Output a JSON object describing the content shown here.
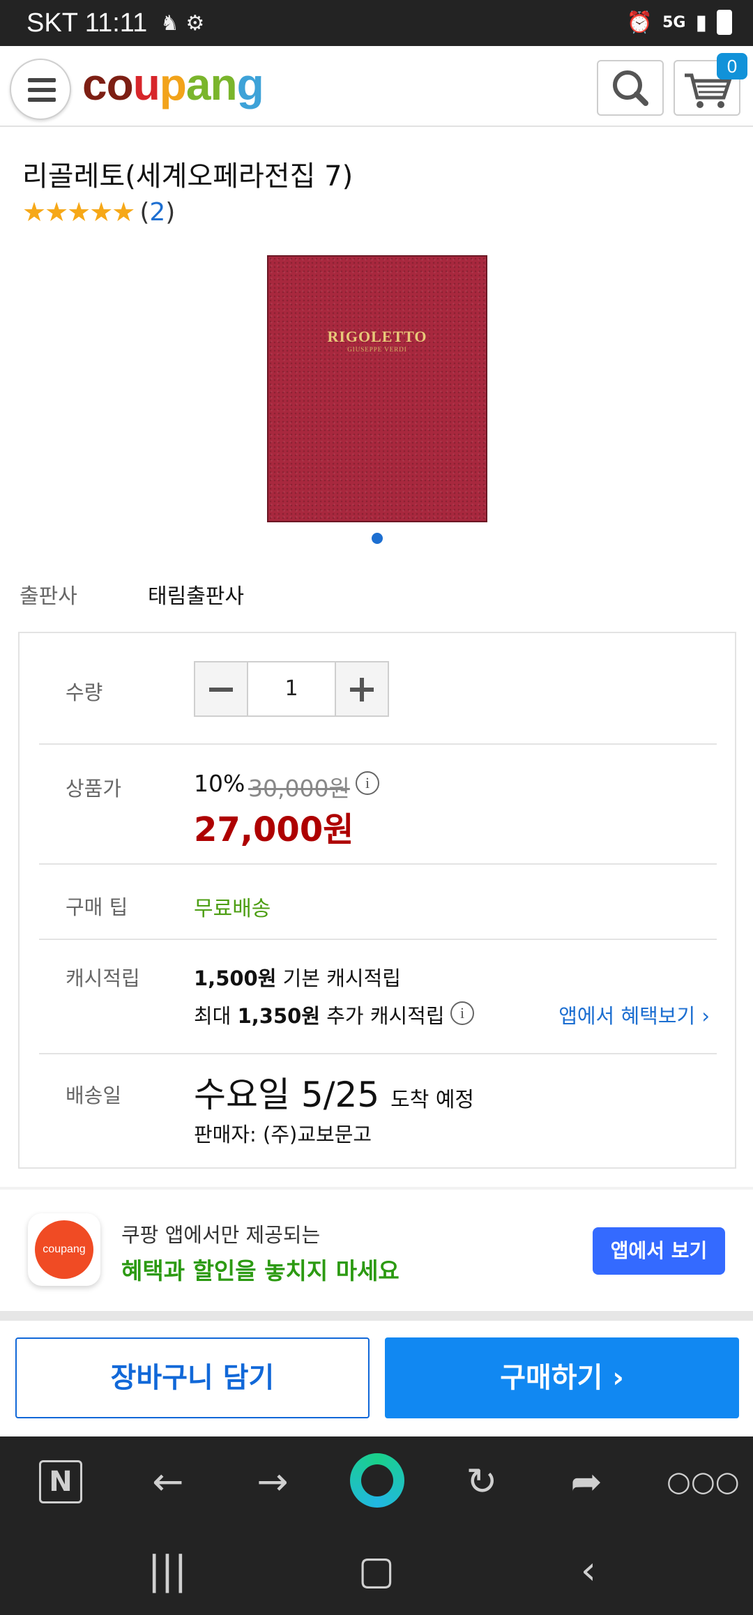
{
  "status_bar": {
    "carrier_time": "SKT 11:11",
    "right_icons": [
      "alarm-icon",
      "5g-icon",
      "signal-icon",
      "battery-icon"
    ]
  },
  "header": {
    "logo_text": "coupang",
    "cart_count": "0"
  },
  "product": {
    "title": "리골레토(세계오페라전집 7)",
    "rating_stars": 5,
    "review_count_open": "(",
    "review_count": "2",
    "review_count_close": ")",
    "book_cover_title": "RIGOLETTO",
    "book_cover_author": "GIUSEPPE VERDI",
    "publisher_label": "출판사",
    "publisher": "태림출판사"
  },
  "details": {
    "quantity_label": "수량",
    "quantity_value": "1",
    "price_label": "상품가",
    "discount_percent": "10%",
    "original_price": "30,000원",
    "sale_price": "27,000원",
    "tip_label": "구매 팁",
    "tip_value": "무료배송",
    "cash_label": "캐시적립",
    "cash_basic_amount": "1,500원",
    "cash_basic_text": "기본 캐시적립",
    "cash_extra_prefix": "최대",
    "cash_extra_amount": "1,350원",
    "cash_extra_text": "추가 캐시적립",
    "cash_link": "앱에서 혜택보기",
    "delivery_label": "배송일",
    "delivery_date": "수요일 5/25",
    "delivery_suffix": "도착 예정",
    "seller": "판매자: (주)교보문고"
  },
  "promo": {
    "badge_text": "coupang",
    "line1": "쿠팡 앱에서만 제공되는",
    "line2": "혜택과 할인을 놓치지 마세요",
    "button": "앱에서 보기"
  },
  "actions": {
    "add_to_cart": "장바구니 담기",
    "buy_now": "구매하기 ›"
  },
  "colors": {
    "accent_blue": "#1188f2",
    "sale_red": "#ae0000",
    "free_shipping_green": "#4c9e12",
    "promo_button": "#346aff"
  }
}
